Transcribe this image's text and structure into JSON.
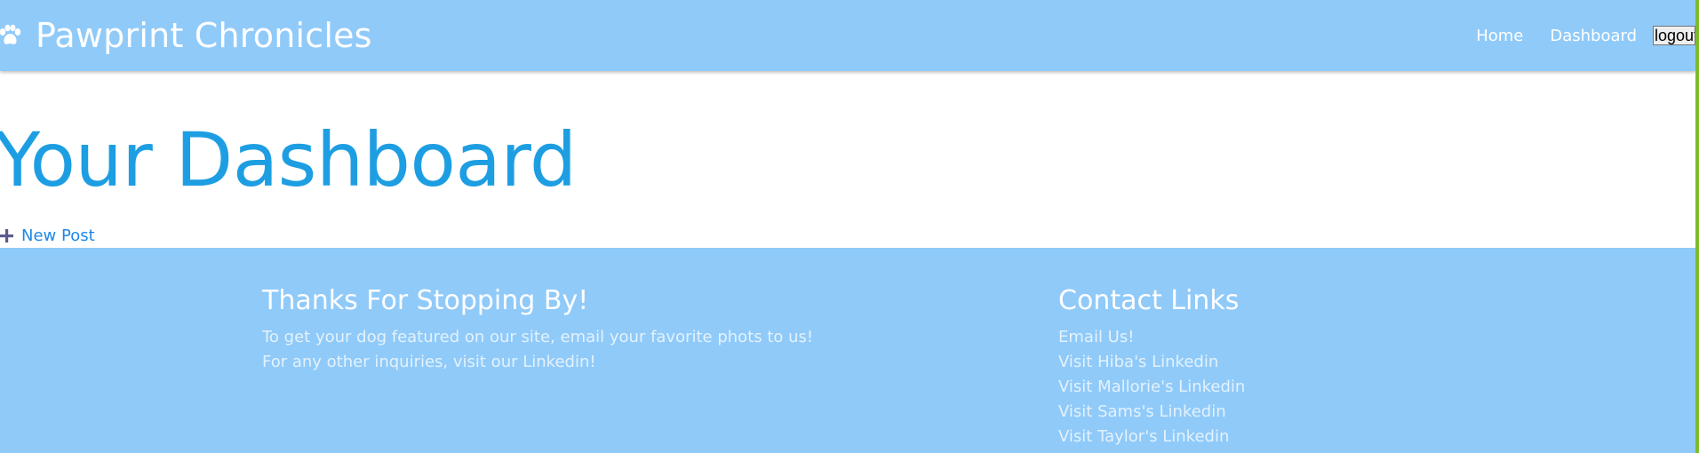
{
  "colors": {
    "navbar_bg": "#90caf9",
    "title_blue": "#1e9ee2",
    "link_blue": "#1e88e5",
    "footer_bg": "#90caf9",
    "plus_icon": "#5c5a8c",
    "edge_strip": "#7dbb2c"
  },
  "navbar": {
    "brand_icon": "paw-icon",
    "brand_title": "Pawprint Chronicles",
    "links": [
      {
        "label": "Home"
      },
      {
        "label": "Dashboard"
      }
    ],
    "logout_label": "logout"
  },
  "main": {
    "title": "Your Dashboard",
    "new_post": {
      "icon": "plus-icon",
      "label": "New Post"
    }
  },
  "footer": {
    "left": {
      "heading": "Thanks For Stopping By!",
      "lines": [
        "To get your dog featured on our site, email your favorite phots to us!",
        "For any other inquiries, visit our Linkedin!"
      ]
    },
    "right": {
      "heading": "Contact Links",
      "links": [
        {
          "label": "Email Us!"
        },
        {
          "label": "Visit Hiba's Linkedin"
        },
        {
          "label": "Visit Mallorie's Linkedin"
        },
        {
          "label": "Visit Sams's Linkedin"
        },
        {
          "label": "Visit Taylor's Linkedin"
        }
      ]
    }
  }
}
